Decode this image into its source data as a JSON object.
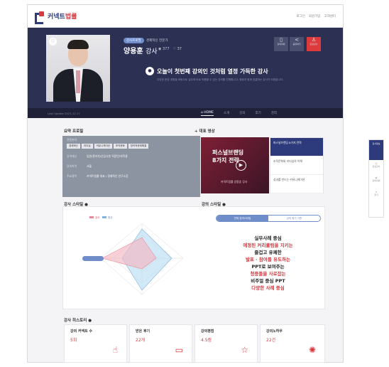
{
  "topbar": {
    "logo_prefix": "커넥트",
    "logo_suffix": "법률",
    "links": [
      "로그인",
      "회원가입",
      "고객센터"
    ]
  },
  "hero": {
    "badge": "강사프로필",
    "field": "경제혁신 전문가",
    "name": "양용훈",
    "name_suffix": "강사",
    "views": "377",
    "likes": "37",
    "buttons": [
      "강의의뢰",
      "공유하기",
      "관심강사"
    ],
    "headline": "오늘이 첫번째 강의인 것처럼 열정 가득한 강사",
    "subline": "다양한 현장 경험을 바탕으로 실무에 바로 적용할 수 있는 강의를 진행합니다. 청중과 함께 호흡하는 강사가 되겠습니다."
  },
  "tabbar": {
    "updated": "Last Update 2021.12.17",
    "tabs": [
      "HOME",
      "소개",
      "강의",
      "후기",
      "경력"
    ]
  },
  "profile": {
    "title": "요약 프로필",
    "rows": [
      {
        "k": "전문분야",
        "v": ""
      },
      {
        "k": "강의대상",
        "v": "임원/관리자/신입사원 직장인/대학생"
      },
      {
        "k": "강의지역",
        "v": "서울"
      },
      {
        "k": "주요경력",
        "v": "커넥트법률 대표 / 경제혁신 연구소장"
      }
    ],
    "chips": [
      "경제혁신",
      "리더십",
      "커뮤니케이션",
      "조직문화",
      "창의적문제해결"
    ]
  },
  "video": {
    "title": "+ 대표 영상",
    "thumb_title": "퍼스널브랜딩 8가지 전략",
    "caption": "커넥트법률 양용훈 강사",
    "list": [
      "퍼스널브랜딩 8가지 전략",
      "조직문화와 리더십의 이해",
      "성과를 만드는 커뮤니케이션"
    ]
  },
  "styles": {
    "title_left": "강사 스타일",
    "title_right": "강의 스타일",
    "legend": [
      "강사",
      "평균"
    ],
    "pill": [
      "전체 강의스타일",
      "강의 평가 기준"
    ],
    "tags": [
      {
        "small": "",
        "text": "실무사례 중심",
        "color": "dark"
      },
      {
        "small": "",
        "text": "예정된 커리큘럼을 지키는",
        "color": "red"
      },
      {
        "small": "",
        "text": "즐겁고 유쾌한",
        "color": "dark"
      },
      {
        "small": "",
        "text": "발표 · 참여를 유도하는",
        "color": "red"
      },
      {
        "small": "",
        "text": "PPT로 보여주는",
        "color": "dark"
      },
      {
        "small": "",
        "text": "청중들을 사로잡는",
        "color": "red"
      },
      {
        "small": "",
        "text": "비주얼 중심 PPT",
        "color": "dark"
      },
      {
        "small": "",
        "text": "다양한 사례 중심",
        "color": "red"
      }
    ]
  },
  "history": {
    "title": "강사 히스토리",
    "items": [
      {
        "label": "강의 커넥트 수",
        "value": "5회"
      },
      {
        "label": "받은 후기",
        "value": "22개"
      },
      {
        "label": "강의평점",
        "value": "4.5점"
      },
      {
        "label": "강의노하우",
        "value": "22건"
      }
    ]
  },
  "sidepanel": {
    "items": [
      "강사정보",
      "관심강사",
      "강의의뢰",
      "후기"
    ]
  },
  "colors": {
    "navy": "#2c3052",
    "accent_red": "#d8383f",
    "accent_blue": "#6f8dc9"
  }
}
